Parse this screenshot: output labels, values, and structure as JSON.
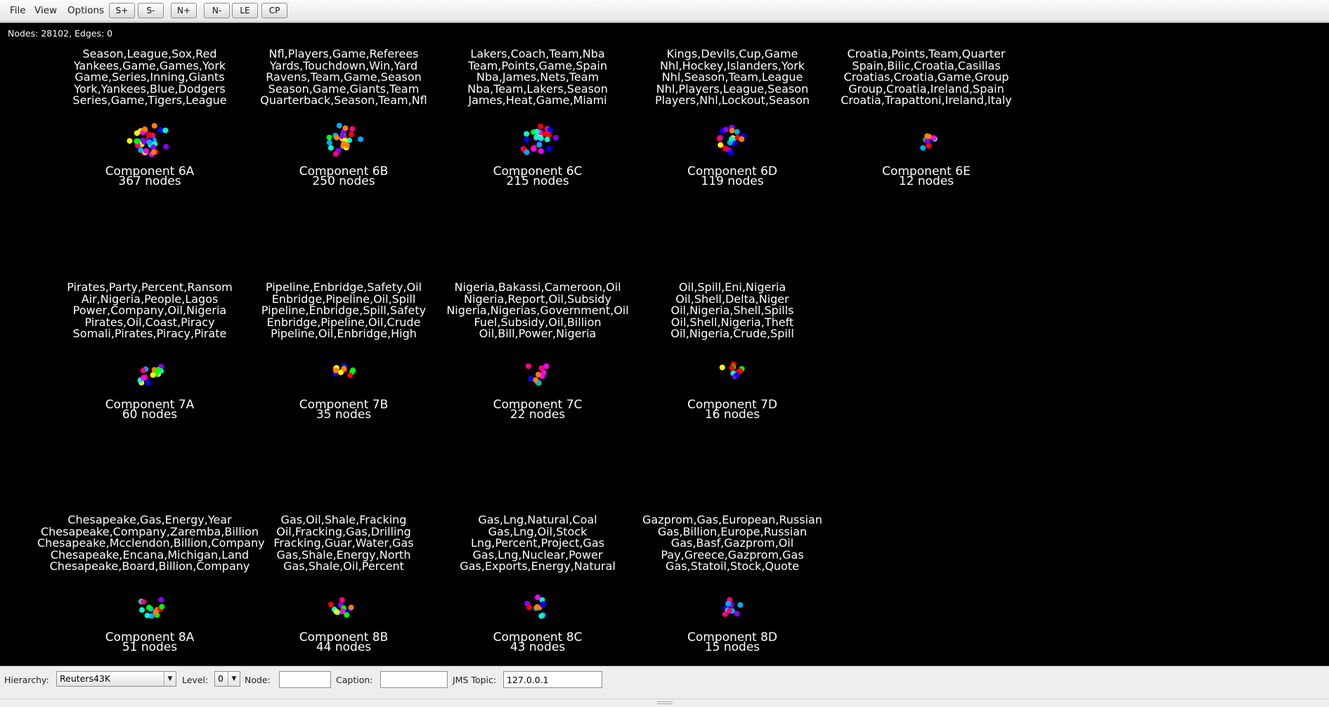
{
  "menubar": {
    "menus": [
      "File",
      "View",
      "Options"
    ],
    "buttons": [
      "S+",
      "S-",
      "N+",
      "N-",
      "LE",
      "CP"
    ]
  },
  "stats": "Nodes: 28102, Edges: 0",
  "components": [
    {
      "name": "Component 6A",
      "count": "367 nodes",
      "words": [
        "Season,League,Sox,Red",
        "Yankees,Game,Games,York",
        "Game,Series,Inning,Giants",
        "York,Yankees,Blue,Dodgers",
        "Series,Game,Tigers,League"
      ]
    },
    {
      "name": "Component 6B",
      "count": "250 nodes",
      "words": [
        "Nfl,Players,Game,Referees",
        "Yards,Touchdown,Win,Yard",
        "Ravens,Team,Game,Season",
        "Season,Game,Giants,Team",
        "Quarterback,Season,Team,Nfl"
      ]
    },
    {
      "name": "Component 6C",
      "count": "215 nodes",
      "words": [
        "Lakers,Coach,Team,Nba",
        "Team,Points,Game,Spain",
        "Nba,James,Nets,Team",
        "Nba,Team,Lakers,Season",
        "James,Heat,Game,Miami"
      ]
    },
    {
      "name": "Component 6D",
      "count": "119 nodes",
      "words": [
        "Kings,Devils,Cup,Game",
        "Nhl,Hockey,Islanders,York",
        "Nhl,Season,Team,League",
        "Nhl,Players,League,Season",
        "Players,Nhl,Lockout,Season"
      ]
    },
    {
      "name": "Component 6E",
      "count": "12 nodes",
      "words": [
        "Croatia,Points,Team,Quarter",
        "Spain,Bilic,Croatia,Casillas",
        "Croatias,Croatia,Game,Group",
        "Group,Croatia,Ireland,Spain",
        "Croatia,Trapattoni,Ireland,Italy"
      ]
    },
    {
      "name": "Component 7A",
      "count": "60 nodes",
      "words": [
        "Pirates,Party,Percent,Ransom",
        "Air,Nigeria,People,Lagos",
        "Power,Company,Oil,Nigeria",
        "Pirates,Oil,Coast,Piracy",
        "Somali,Pirates,Piracy,Pirate"
      ]
    },
    {
      "name": "Component 7B",
      "count": "35 nodes",
      "words": [
        "Pipeline,Enbridge,Safety,Oil",
        "Enbridge,Pipeline,Oil,Spill",
        "Pipeline,Enbridge,Spill,Safety",
        "Enbridge,Pipeline,Oil,Crude",
        "Pipeline,Oil,Enbridge,High"
      ]
    },
    {
      "name": "Component 7C",
      "count": "22 nodes",
      "words": [
        "Nigeria,Bakassi,Cameroon,Oil",
        "Nigeria,Report,Oil,Subsidy",
        "Nigeria,Nigerias,Government,Oil",
        "Fuel,Subsidy,Oil,Billion",
        "Oil,Bill,Power,Nigeria"
      ]
    },
    {
      "name": "Component 7D",
      "count": "16 nodes",
      "words": [
        "Oil,Spill,Eni,Nigeria",
        "Oil,Shell,Delta,Niger",
        "Oil,Nigeria,Shell,Spills",
        "Oil,Shell,Nigeria,Theft",
        "Oil,Nigeria,Crude,Spill"
      ]
    },
    {
      "name": "Component 8A",
      "count": "51 nodes",
      "words": [
        "Chesapeake,Gas,Energy,Year",
        "Chesapeake,Company,Zaremba,Billion",
        "Chesapeake,Mcclendon,Billion,Company",
        "Chesapeake,Encana,Michigan,Land",
        "Chesapeake,Board,Billion,Company"
      ]
    },
    {
      "name": "Component 8B",
      "count": "44 nodes",
      "words": [
        "Gas,Oil,Shale,Fracking",
        "Oil,Fracking,Gas,Drilling",
        "Fracking,Guar,Water,Gas",
        "Gas,Shale,Energy,North",
        "Gas,Shale,Oil,Percent"
      ]
    },
    {
      "name": "Component 8C",
      "count": "43 nodes",
      "words": [
        "Gas,Lng,Natural,Coal",
        "Gas,Lng,Oil,Stock",
        "Lng,Percent,Project,Gas",
        "Gas,Lng,Nuclear,Power",
        "Gas,Exports,Energy,Natural"
      ]
    },
    {
      "name": "Component 8D",
      "count": "15 nodes",
      "words": [
        "Gazprom,Gas,European,Russian",
        "Gas,Billion,Europe,Russian",
        "Gas,Basf,Gazprom,Oil",
        "Pay,Greece,Gazprom,Gas",
        "Gas,Statoil,Stock,Quote"
      ]
    }
  ],
  "colors": {
    "canvas_bg": "#000000",
    "text": "#ffffff",
    "node_palette": [
      "#ff0000",
      "#ff7f00",
      "#ffff00",
      "#00ff00",
      "#00ffcc",
      "#00aaff",
      "#0000ff",
      "#8800ff",
      "#ff00ff",
      "#ff0080"
    ]
  },
  "statusbar": {
    "hierarchy_label": "Hierarchy:",
    "hierarchy_value": "Reuters43K",
    "level_label": "Level:",
    "level_value": "0",
    "node_label": "Node:",
    "node_value": "",
    "caption_label": "Caption:",
    "caption_value": "",
    "jms_label": "JMS Topic:",
    "jms_value": "127.0.0.1"
  }
}
